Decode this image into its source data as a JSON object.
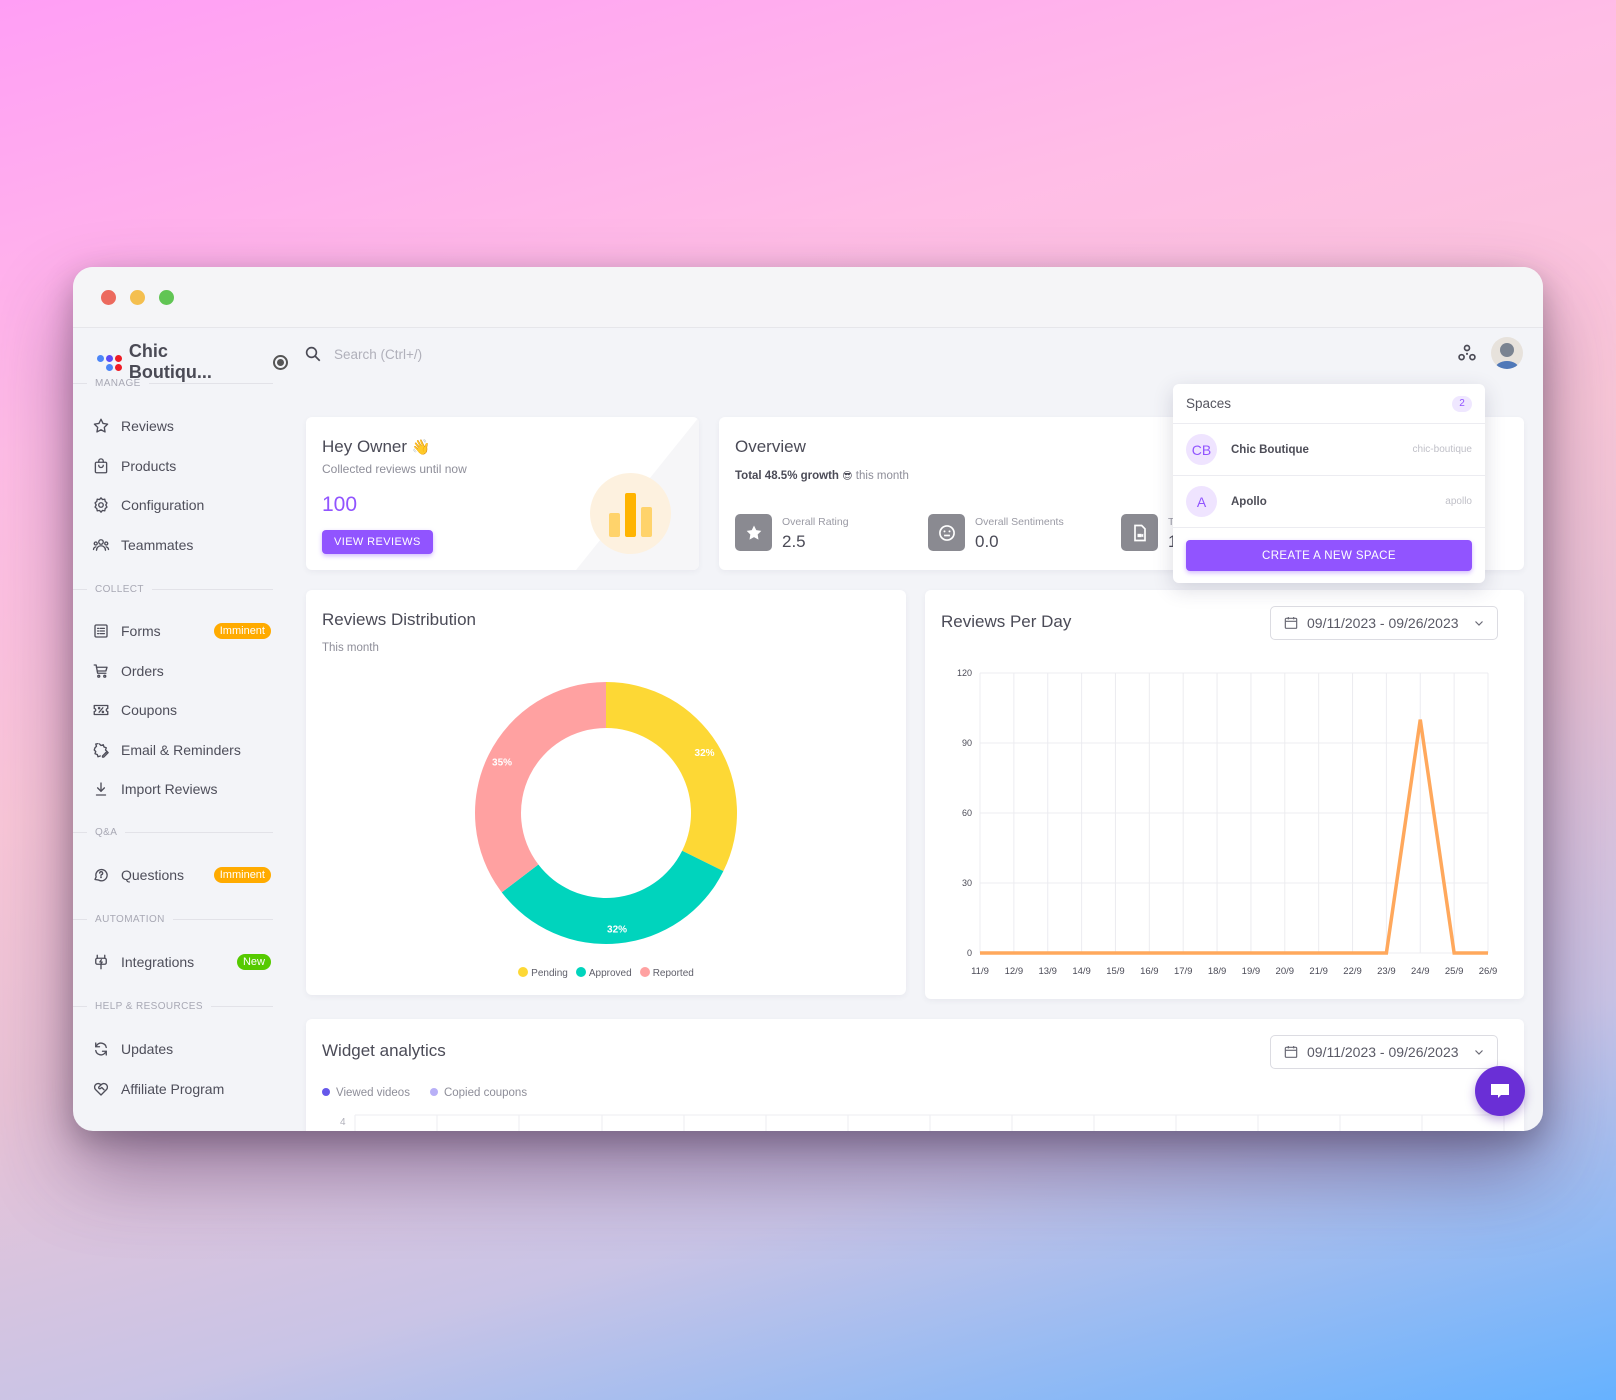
{
  "window": {
    "controls": [
      "close",
      "minimize",
      "maximize"
    ]
  },
  "brand": {
    "name": "Chic Boutiqu...",
    "logo_colors": [
      "#4b86f7",
      "#5b4bf5",
      "#ee1c25"
    ]
  },
  "search": {
    "placeholder": "Search (Ctrl+/)"
  },
  "sidebar": {
    "sections": [
      {
        "label": "MANAGE",
        "items": [
          {
            "label": "Reviews",
            "icon": "star-icon"
          },
          {
            "label": "Products",
            "icon": "shopping-bag-icon"
          },
          {
            "label": "Configuration",
            "icon": "gear-icon"
          },
          {
            "label": "Teammates",
            "icon": "users-icon"
          }
        ]
      },
      {
        "label": "COLLECT",
        "items": [
          {
            "label": "Forms",
            "icon": "form-list-icon",
            "badge": "Imminent"
          },
          {
            "label": "Orders",
            "icon": "cart-icon"
          },
          {
            "label": "Coupons",
            "icon": "coupon-icon"
          },
          {
            "label": "Email & Reminders",
            "icon": "email-edit-icon"
          },
          {
            "label": "Import Reviews",
            "icon": "download-icon"
          }
        ]
      },
      {
        "label": "Q&A",
        "items": [
          {
            "label": "Questions",
            "icon": "question-bubble-icon",
            "badge": "Imminent"
          }
        ]
      },
      {
        "label": "AUTOMATION",
        "items": [
          {
            "label": "Integrations",
            "icon": "plug-icon",
            "badge": "New"
          }
        ]
      },
      {
        "label": "HELP & RESOURCES",
        "items": [
          {
            "label": "Updates",
            "icon": "refresh-icon"
          },
          {
            "label": "Affiliate Program",
            "icon": "heart-handshake-icon"
          }
        ]
      }
    ],
    "badge_colors": {
      "Imminent": "#ffab00",
      "New": "#56ca00"
    }
  },
  "welcome": {
    "title": "Hey Owner",
    "emoji": "👋",
    "subtitle": "Collected reviews until now",
    "count": "100",
    "button": "VIEW REVIEWS"
  },
  "overview": {
    "title": "Overview",
    "growth_bold": "Total 48.5% growth",
    "growth_emoji": "😎",
    "growth_rest": "this month",
    "stats": [
      {
        "label": "Overall Rating",
        "value": "2.5",
        "icon": "star-icon"
      },
      {
        "label": "Overall Sentiments",
        "value": "0.0",
        "icon": "neutral-face-icon"
      },
      {
        "label": "T",
        "value": "1",
        "icon": "video-file-icon"
      }
    ]
  },
  "spaces_dropdown": {
    "title": "Spaces",
    "count": "2",
    "items": [
      {
        "initials": "CB",
        "name": "Chic Boutique",
        "slug": "chic-boutique"
      },
      {
        "initials": "A",
        "name": "Apollo",
        "slug": "apollo"
      }
    ],
    "button": "CREATE A NEW SPACE"
  },
  "distribution": {
    "title": "Reviews Distribution",
    "subtitle": "This month"
  },
  "reviews_per_day": {
    "title": "Reviews Per Day",
    "date_range": "09/11/2023 - 09/26/2023"
  },
  "widget_analytics": {
    "title": "Widget analytics",
    "date_range": "09/11/2023 - 09/26/2023",
    "legend": [
      {
        "label": "Viewed videos",
        "color": "#6658ea"
      },
      {
        "label": "Copied coupons",
        "color": "#b8b0f7"
      }
    ],
    "first_tick": "4"
  },
  "chart_data": [
    {
      "type": "pie",
      "title": "Reviews Distribution",
      "subtitle": "This month",
      "categories": [
        "Pending",
        "Approved",
        "Reported"
      ],
      "values": [
        32,
        32,
        35
      ],
      "labels": [
        "32%",
        "32%",
        "35%"
      ],
      "colors": [
        "#fdd835",
        "#00d4bd",
        "#ffa1a1"
      ],
      "donut": true,
      "legend": "bottom"
    },
    {
      "type": "line",
      "title": "Reviews Per Day",
      "x": [
        "11/9",
        "12/9",
        "13/9",
        "14/9",
        "15/9",
        "16/9",
        "17/9",
        "18/9",
        "19/9",
        "20/9",
        "21/9",
        "22/9",
        "23/9",
        "24/9",
        "25/9",
        "26/9"
      ],
      "series": [
        {
          "name": "Reviews",
          "values": [
            0,
            0,
            0,
            0,
            0,
            0,
            0,
            0,
            0,
            0,
            0,
            0,
            0,
            100,
            0,
            0
          ],
          "color": "#ffa85c"
        }
      ],
      "yticks": [
        0,
        30,
        60,
        90,
        120
      ],
      "ylim": [
        0,
        120
      ],
      "grid": true
    }
  ]
}
